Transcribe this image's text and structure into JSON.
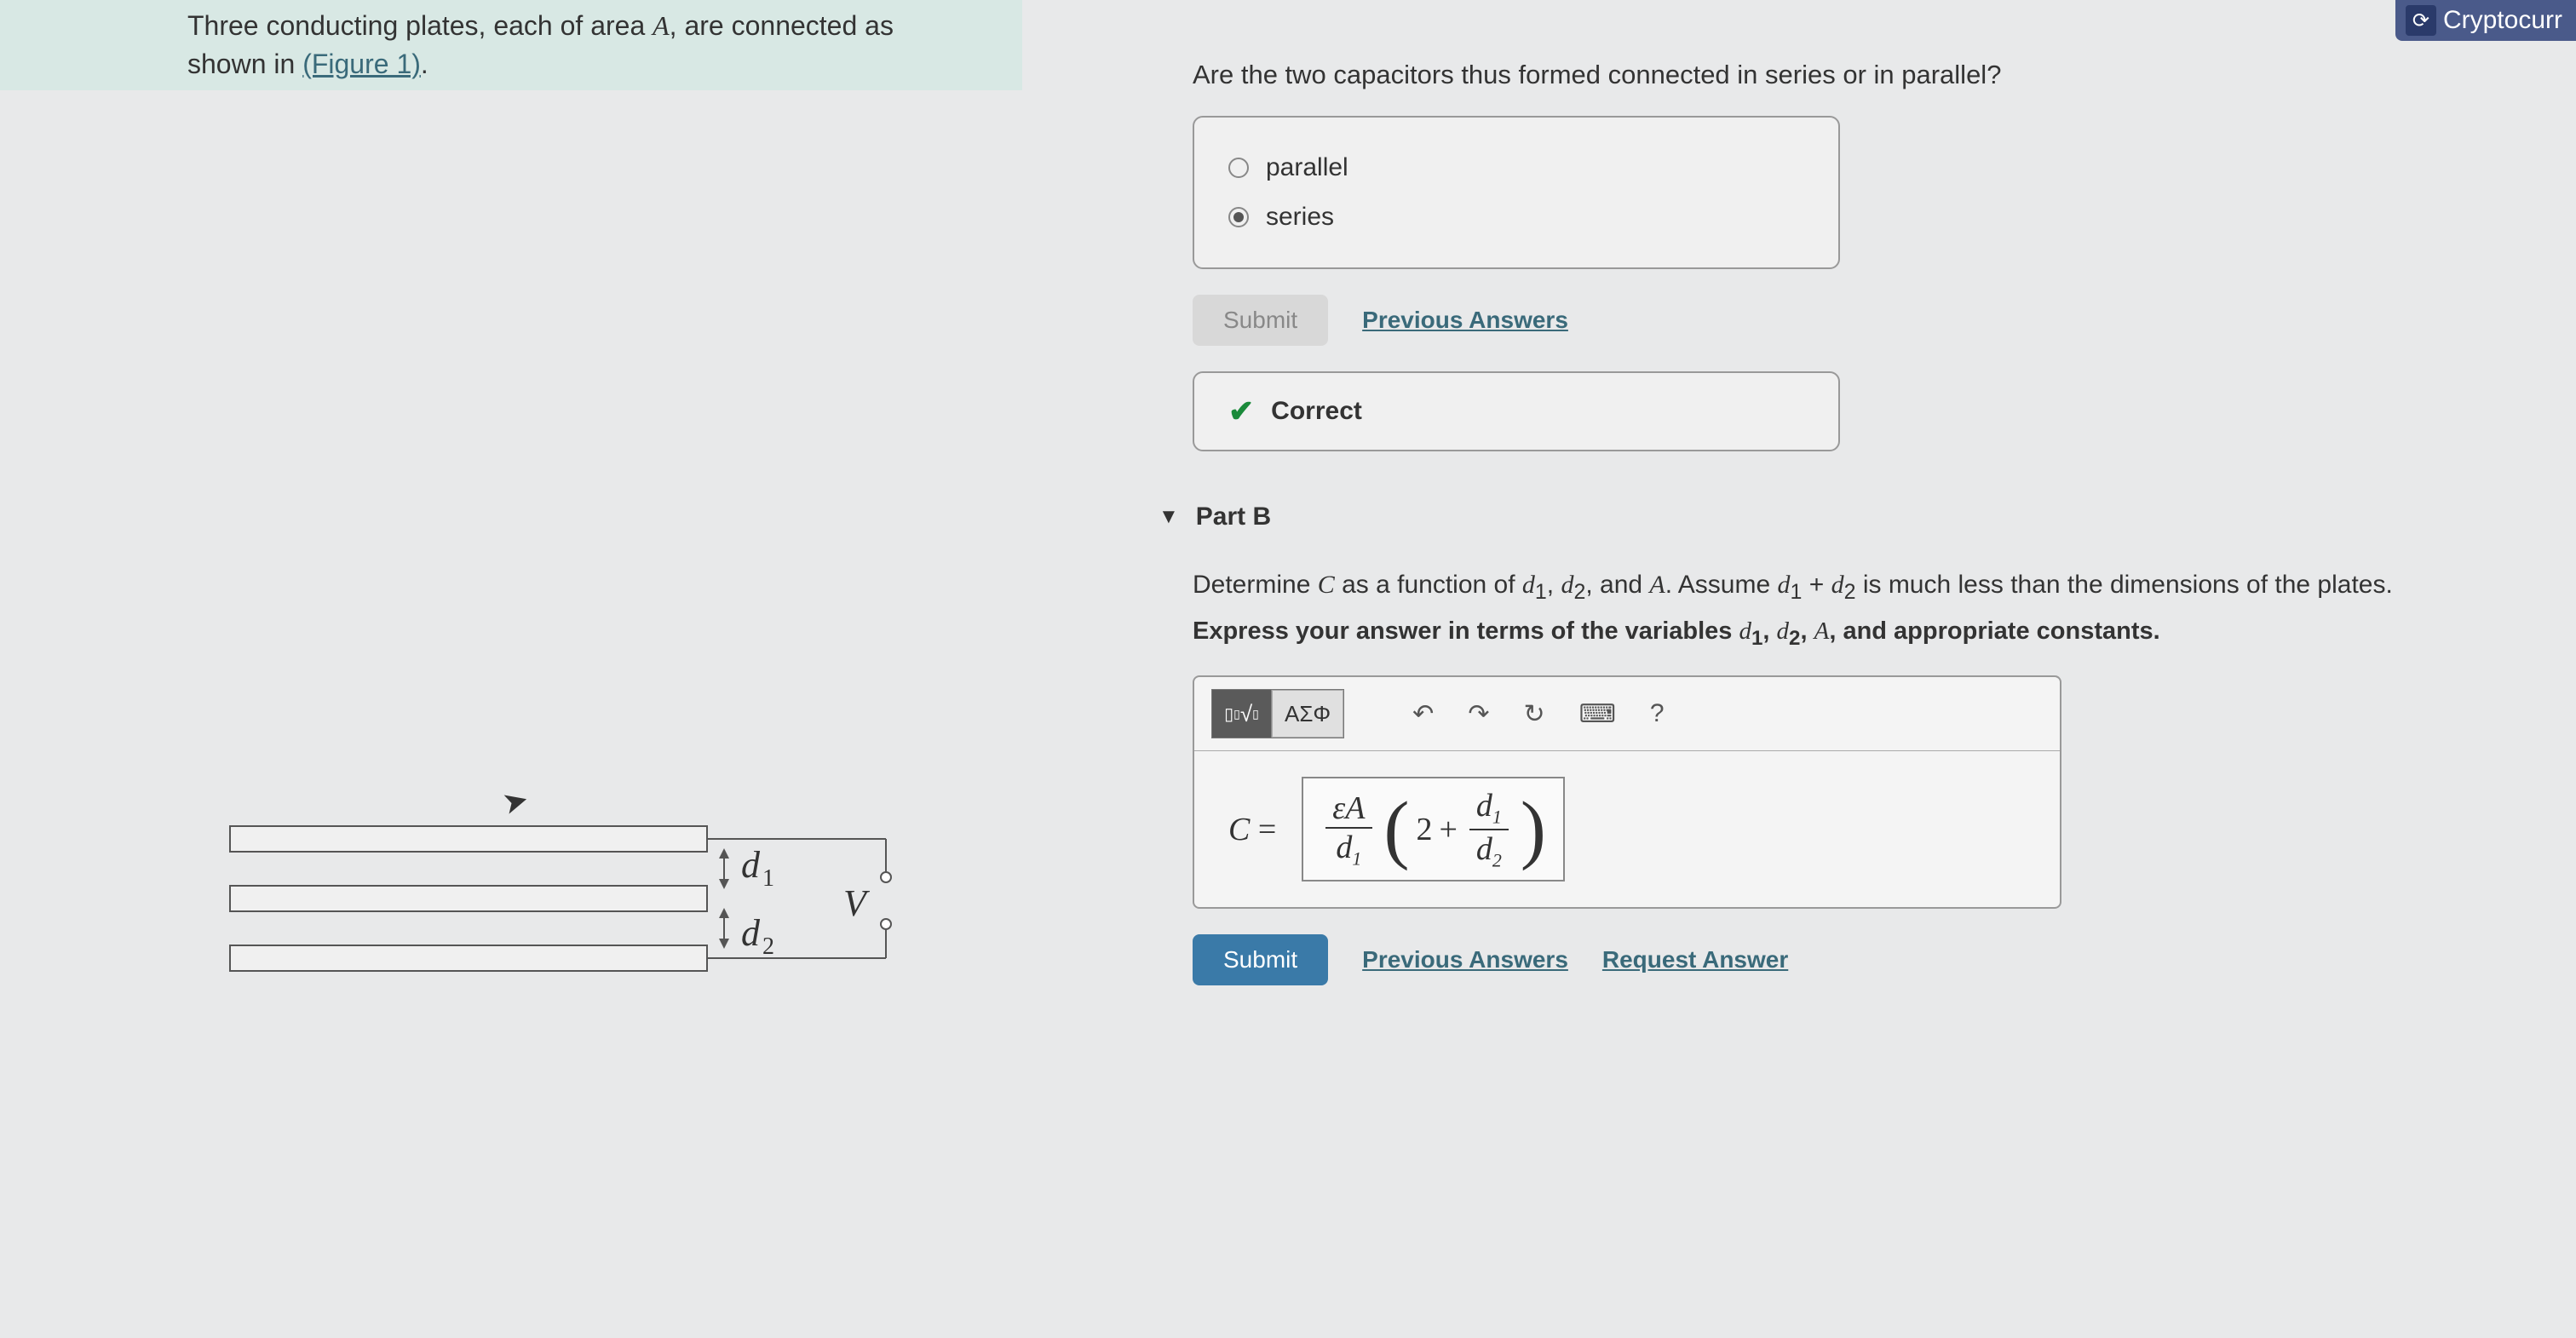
{
  "crypto": {
    "label": "Cryptocurr",
    "icon": "⟳"
  },
  "problem": {
    "line1": "Three conducting plates, each of area ",
    "var_A": "A",
    "line1b": ", are connected as",
    "line2": "shown in ",
    "figure_link": "(Figure 1)",
    "period": "."
  },
  "figure": {
    "d1": "d",
    "d1_sub": "1",
    "d2": "d",
    "d2_sub": "2",
    "V": "V"
  },
  "partA": {
    "question": "Are the two capacitors thus formed connected in series or in parallel?",
    "opt1": "parallel",
    "opt2": "series",
    "submit": "Submit",
    "prev": "Previous Answers",
    "correct": "Correct"
  },
  "partB": {
    "header": "Part B",
    "text1": "Determine ",
    "var_C": "C",
    "text1b": " as a function of ",
    "d1": "d",
    "d1s": "1",
    "d2": "d",
    "d2s": "2",
    "comma": ", ",
    "and": ", and ",
    "var_A": "A",
    "text1c": ". Assume ",
    "plus": " + ",
    "text1d": " is much less than the dimensions of the plates.",
    "bold": "Express your answer in terms of the variables ",
    "bold2": ", and appropriate constants.",
    "toolbar": {
      "templates": "▯√▯",
      "greek": "ΑΣΦ",
      "undo": "↶",
      "redo": "↷",
      "reset": "↻",
      "keyboard": "⌨",
      "help": "?"
    },
    "formula": {
      "C": "C",
      "eq": " = ",
      "eps": "ε",
      "A": "A",
      "two": "2",
      "plus": " + "
    },
    "submit": "Submit",
    "prev": "Previous Answers",
    "request": "Request Answer"
  }
}
